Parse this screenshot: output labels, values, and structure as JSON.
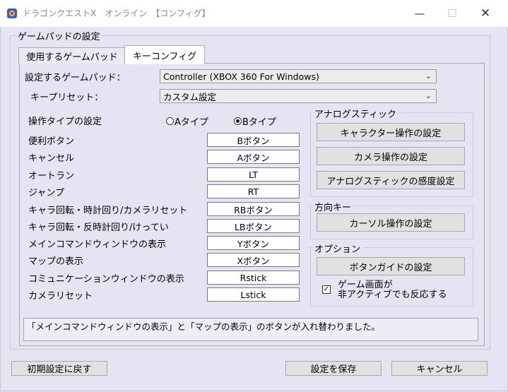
{
  "window": {
    "title": "ドラゴンクエストX　オンライン　【コンフィグ】",
    "min_glyph": "—",
    "max_glyph": "☐",
    "close_glyph": "✕"
  },
  "group_title": "ゲームパッドの設定",
  "tabs": [
    {
      "label": "使用するゲームパッド",
      "active": false
    },
    {
      "label": "キーコンフィグ",
      "active": true
    }
  ],
  "gamepad": {
    "label": "設定するゲームパッド：",
    "value": "Controller (XBOX 360 For Windows)"
  },
  "preset": {
    "label": "キープリセット：",
    "value": "カスタム設定"
  },
  "operation_type": {
    "label": "操作タイプの設定",
    "options": [
      {
        "label": "Aタイプ",
        "selected": false
      },
      {
        "label": "Bタイプ",
        "selected": true
      }
    ]
  },
  "key_rows": [
    {
      "label": "便利ボタン",
      "value": "Bボタン"
    },
    {
      "label": "キャンセル",
      "value": "Aボタン"
    },
    {
      "label": "オートラン",
      "value": "LT"
    },
    {
      "label": "ジャンプ",
      "value": "RT"
    },
    {
      "label": "キャラ回転・時計回り/カメラリセット",
      "value": "RBボタン"
    },
    {
      "label": "キャラ回転・反時計回り/けってい",
      "value": "LBボタン"
    },
    {
      "label": "メインコマンドウィンドウの表示",
      "value": "Yボタン"
    },
    {
      "label": "マップの表示",
      "value": "Xボタン"
    },
    {
      "label": "コミュニケーションウィンドウの表示",
      "value": "Rstick"
    },
    {
      "label": "カメラリセット",
      "value": "Lstick"
    }
  ],
  "analog": {
    "title": "アナログスティック",
    "buttons": [
      "キャラクター操作の設定",
      "カメラ操作の設定",
      "アナログスティックの感度設定"
    ]
  },
  "direction": {
    "title": "方向キー",
    "button": "カーソル操作の設定"
  },
  "options": {
    "title": "オプション",
    "button": "ボタンガイドの設定",
    "checkbox_line1": "ゲーム画面が",
    "checkbox_line2": "非アクティブでも反応する",
    "checkbox_checked": true
  },
  "status": "「メインコマンドウィンドウの表示」と「マップの表示」のボタンが入れ替わりました。",
  "footer": {
    "reset": "初期設定に戻す",
    "save": "設定を保存",
    "cancel": "キャンセル"
  }
}
